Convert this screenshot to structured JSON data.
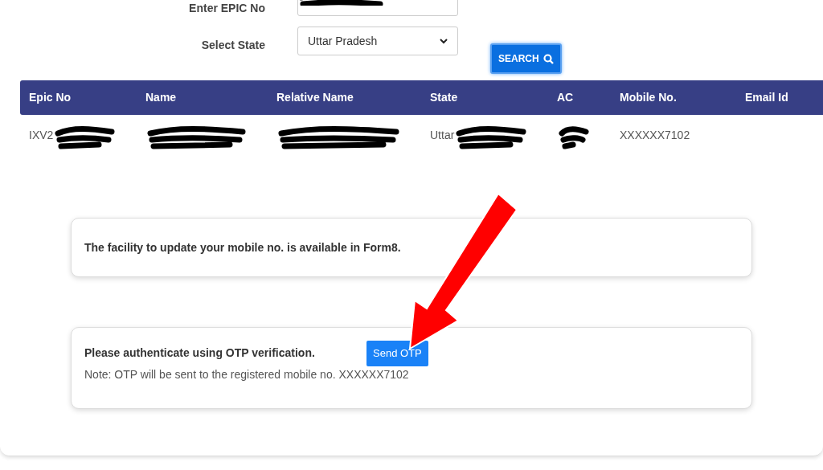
{
  "form": {
    "epic_label": "Enter EPIC No",
    "epic_redacted": true,
    "state_label": "Select State",
    "state_value": "Uttar Pradesh",
    "search_button": "SEARCH"
  },
  "table": {
    "columns": [
      "Epic No",
      "Name",
      "Relative Name",
      "State",
      "AC",
      "Mobile No.",
      "Email Id"
    ],
    "rows": [
      {
        "cells": [
          {
            "text": "IXV2",
            "redacted": true
          },
          {
            "redacted": true
          },
          {
            "redacted": true
          },
          {
            "text": "Uttar",
            "redacted": true
          },
          {
            "redacted": true
          },
          {
            "text": "XXXXXX7102"
          },
          {}
        ]
      }
    ]
  },
  "notice": {
    "text": "The facility to update your mobile no. is available in Form8."
  },
  "otp": {
    "prompt": "Please authenticate using OTP verification.",
    "button": "Send OTP",
    "note": "Note: OTP will be sent to the registered mobile no. XXXXXX7102"
  }
}
